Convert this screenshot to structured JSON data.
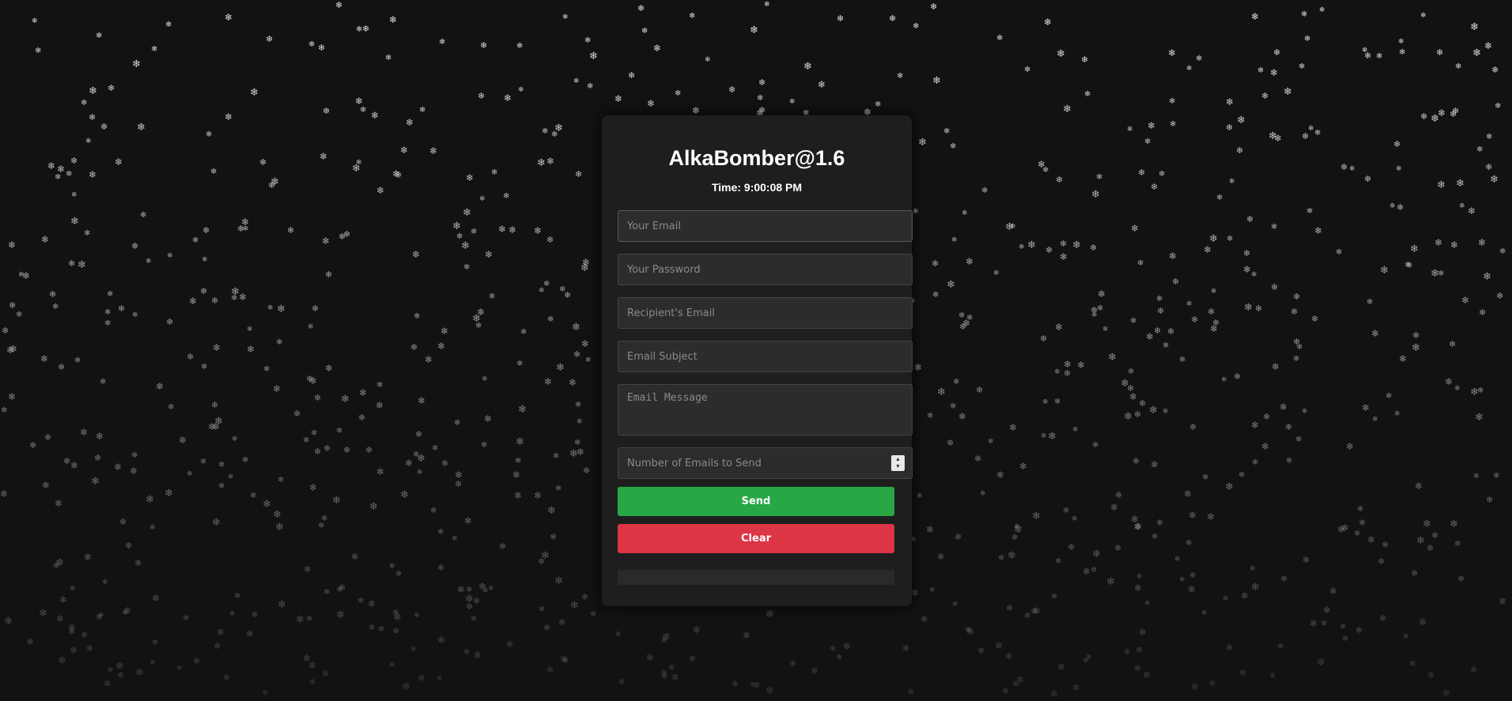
{
  "app": {
    "title": "AlkaBomber@1.6",
    "time_label": "Time: 9:00:08 PM"
  },
  "form": {
    "email_placeholder": "Your Email",
    "password_placeholder": "Your Password",
    "recipient_placeholder": "Recipient's Email",
    "subject_placeholder": "Email Subject",
    "message_placeholder": "Email Message",
    "count_placeholder": "Number of Emails to Send",
    "send_label": "Send",
    "clear_label": "Clear"
  },
  "background": {
    "snowflake_icon": "snowflake-icon",
    "snowflake_glyph": "❄",
    "snowflake_color": "#e0e0e0"
  },
  "colors": {
    "background": "#121212",
    "card": "#1e1e1e",
    "send": "#28a745",
    "clear": "#dc3545"
  }
}
